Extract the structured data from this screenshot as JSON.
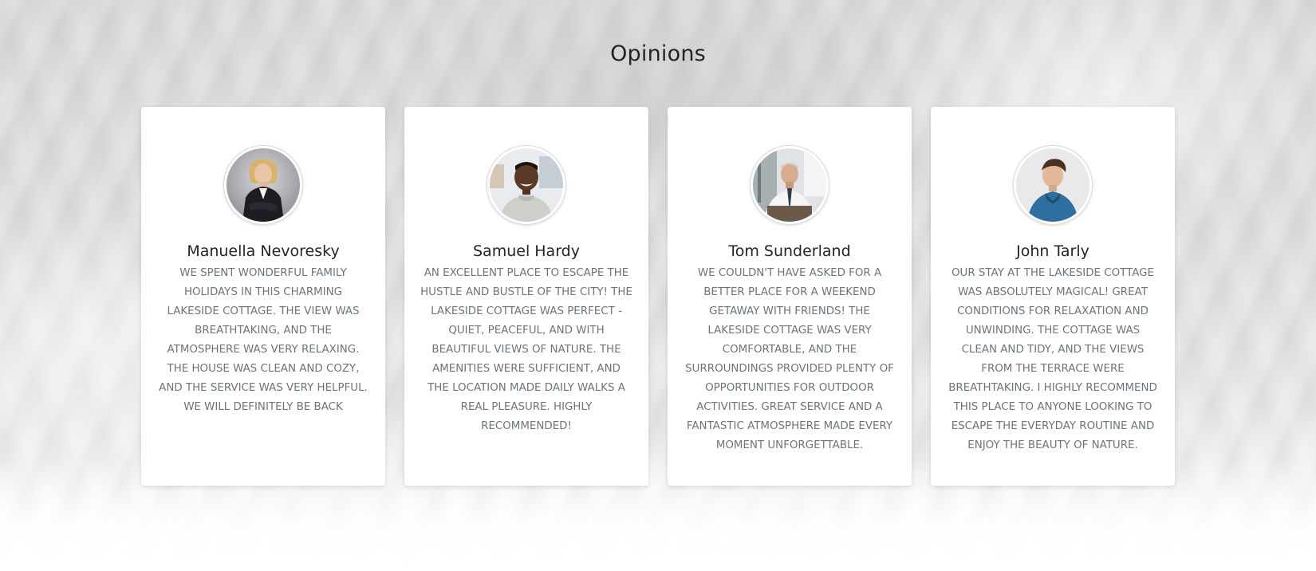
{
  "section": {
    "title": "Opinions"
  },
  "testimonials": [
    {
      "name": "Manuella Nevoresky",
      "text": "WE SPENT WONDERFUL FAMILY HOLIDAYS IN THIS CHARMING LAKESIDE COTTAGE. THE VIEW WAS BREATHTAKING, AND THE ATMOSPHERE WAS VERY RELAXING. THE HOUSE WAS CLEAN AND COZY, AND THE SERVICE WAS VERY HELPFUL. WE WILL DEFINITELY BE BACK",
      "avatar": "woman-in-suit-photo"
    },
    {
      "name": "Samuel Hardy",
      "text": "AN EXCELLENT PLACE TO ESCAPE THE HUSTLE AND BUSTLE OF THE CITY! THE LAKESIDE COTTAGE WAS PERFECT - QUIET, PEACEFUL, AND WITH BEAUTIFUL VIEWS OF NATURE. THE AMENITIES WERE SUFFICIENT, AND THE LOCATION MADE DAILY WALKS A REAL PLEASURE. HIGHLY RECOMMENDED!",
      "avatar": "smiling-man-photo"
    },
    {
      "name": "Tom Sunderland",
      "text": "WE COULDN'T HAVE ASKED FOR A BETTER PLACE FOR A WEEKEND GETAWAY WITH FRIENDS! THE LAKESIDE COTTAGE WAS VERY COMFORTABLE, AND THE SURROUNDINGS PROVIDED PLENTY OF OPPORTUNITIES FOR OUTDOOR ACTIVITIES. GREAT SERVICE AND A FANTASTIC ATMOSPHERE MADE EVERY MOMENT UNFORGETTABLE.",
      "avatar": "older-man-in-office-photo"
    },
    {
      "name": "John Tarly",
      "text": "OUR STAY AT THE LAKESIDE COTTAGE WAS ABSOLUTELY MAGICAL! GREAT CONDITIONS FOR RELAXATION AND UNWINDING. THE COTTAGE WAS CLEAN AND TIDY, AND THE VIEWS FROM THE TERRACE WERE BREATHTAKING. I HIGHLY RECOMMEND THIS PLACE TO ANYONE LOOKING TO ESCAPE THE EVERYDAY ROUTINE AND ENJOY THE BEAUTY OF NATURE.",
      "avatar": "young-man-in-denim-photo"
    }
  ]
}
